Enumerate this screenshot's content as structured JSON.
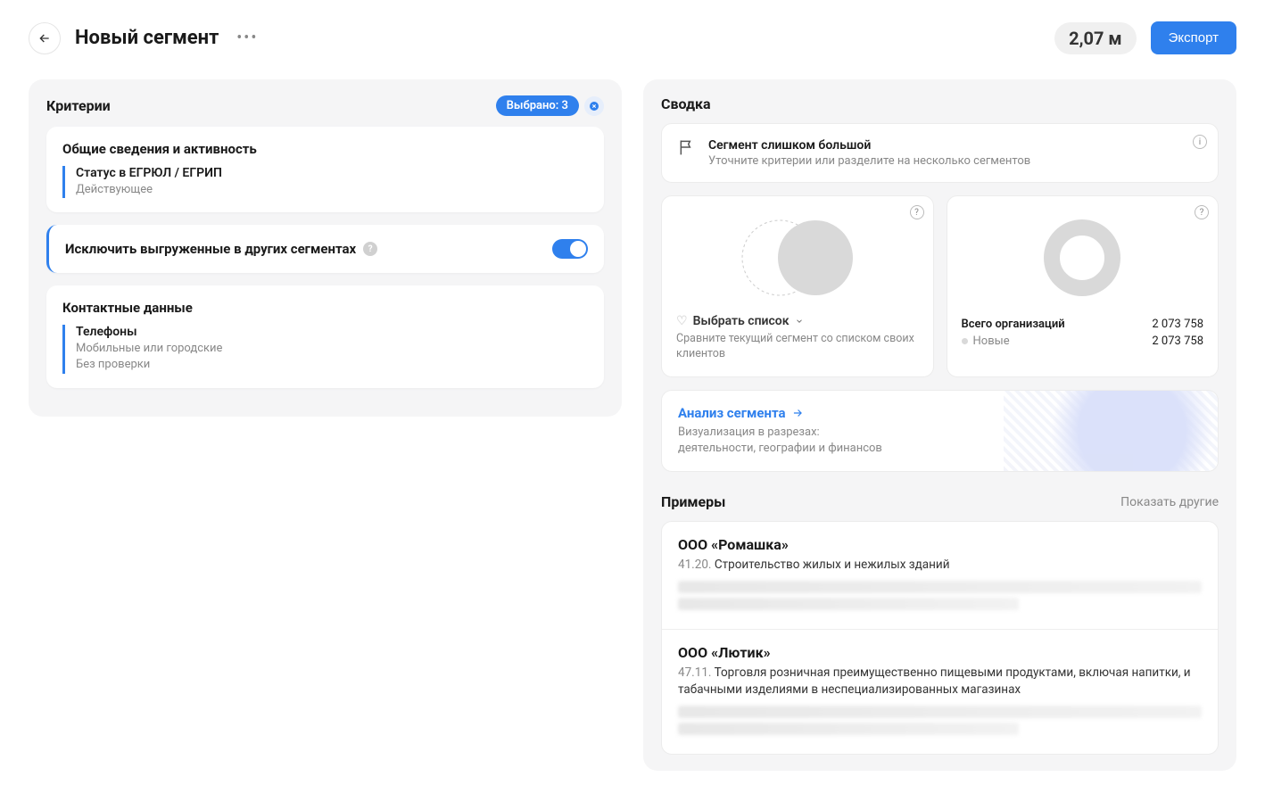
{
  "header": {
    "title": "Новый сегмент",
    "count": "2,07 м",
    "export_label": "Экспорт"
  },
  "criteria": {
    "title": "Критерии",
    "selected_label": "Выбрано: 3",
    "groups": [
      {
        "title": "Общие сведения и активность",
        "item_title": "Статус в ЕГРЮЛ / ЕГРИП",
        "item_sub": "Действующее"
      }
    ],
    "exclude_toggle_label": "Исключить выгруженные в других сегментах",
    "contacts": {
      "title": "Контактные данные",
      "item_title": "Телефоны",
      "item_sub1": "Мобильные или городские",
      "item_sub2": "Без проверки"
    }
  },
  "summary": {
    "title": "Сводка",
    "alert_title": "Сегмент слишком большой",
    "alert_sub": "Уточните критерии или разделите на несколько сегментов",
    "compare": {
      "select_label": "Выбрать список",
      "desc": "Сравните текущий сегмент со списком своих клиентов"
    },
    "totals": {
      "label_total": "Всего организаций",
      "value_total": "2 073 758",
      "label_new": "Новые",
      "value_new": "2 073 758"
    },
    "analysis": {
      "title": "Анализ сегмента",
      "sub_line1": "Визуализация в разрезах:",
      "sub_line2": "деятельности, географии и финансов"
    }
  },
  "examples": {
    "title": "Примеры",
    "show_other": "Показать другие",
    "items": [
      {
        "name": "ООО «Ромашка»",
        "code": "41.20.",
        "activity": "Строительство жилых и нежилых зданий"
      },
      {
        "name": "ООО «Лютик»",
        "code": "47.11.",
        "activity": "Торговля розничная преимущественно пищевыми продуктами, включая напитки, и табачными изделиями в неспециализированных магазинах"
      }
    ]
  },
  "chart_data": {
    "type": "pie",
    "title": "Всего организаций",
    "series": [
      {
        "name": "Новые",
        "value": 2073758
      }
    ],
    "total": 2073758
  }
}
